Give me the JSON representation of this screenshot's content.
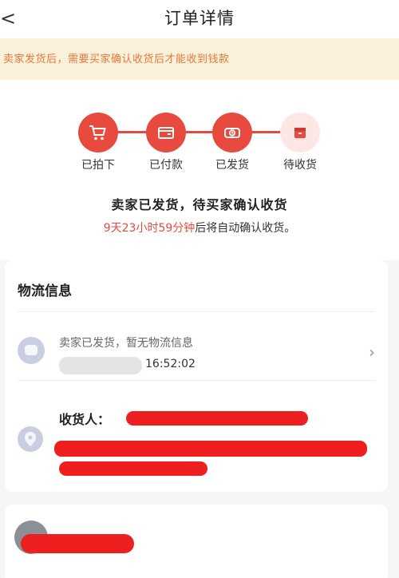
{
  "header": {
    "title": "订单详情",
    "back_glyph": "<",
    "back_icon": "chevron-left-icon"
  },
  "notice": {
    "text": "卖家发货后，需要买家确认收货后才能收到钱款"
  },
  "progress": {
    "steps": [
      {
        "label": "已拍下",
        "icon": "cart-icon",
        "done": true
      },
      {
        "label": "已付款",
        "icon": "wallet-icon",
        "done": true
      },
      {
        "label": "已发货",
        "icon": "truck-icon",
        "done": true
      },
      {
        "label": "待收货",
        "icon": "box-icon",
        "done": false
      }
    ],
    "active_color": "#e84a3e",
    "pending_color": "#fde7e4"
  },
  "status": {
    "main": "卖家已发货，待买家确认收货",
    "countdown": "9天23小时59分钟",
    "countdown_suffix": "后将自动确认收货。"
  },
  "logistics": {
    "title": "物流信息",
    "status": "卖家已发货，暂无物流信息",
    "time": "16:52:02",
    "chevron": "›"
  },
  "address": {
    "receiver_label": "收货人："
  }
}
